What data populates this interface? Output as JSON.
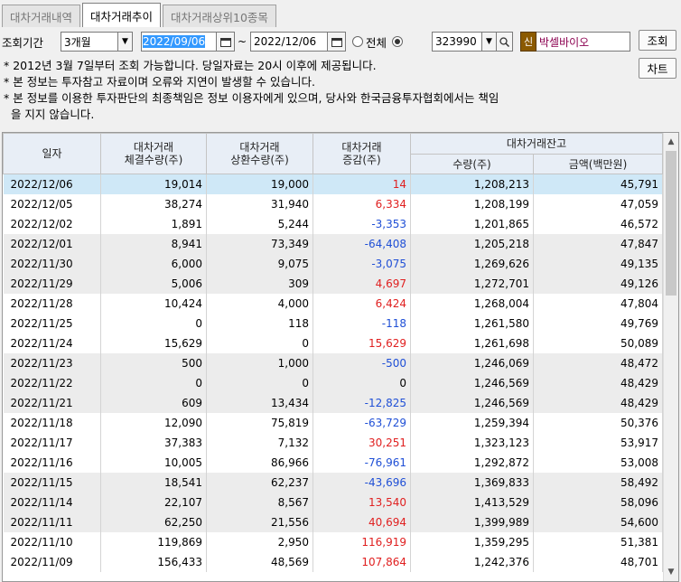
{
  "tabs": [
    "대차거래내역",
    "대차거래추이",
    "대차거래상위10종목"
  ],
  "filter": {
    "period_label": "조회기간",
    "period_value": "3개월",
    "date_from": "2022/09/06",
    "date_sep": "~",
    "date_to": "2022/12/06",
    "radio_all": "전체",
    "stock_code": "323990",
    "shin_badge": "신",
    "stock_name": "박셀바이오",
    "query_button": "조회",
    "chart_button": "차트"
  },
  "notes": [
    "* 2012년 3월 7일부터 조회 가능합니다. 당일자료는 20시 이후에 제공됩니다.",
    "* 본 정보는 투자참고 자료이며 오류와 지연이 발생할 수 있습니다.",
    "* 본 정보를 이용한 투자판단의 최종책임은 정보 이용자에게 있으며, 당사와 한국금융투자협회에서는 책임",
    "  을 지지 않습니다."
  ],
  "table": {
    "headers": {
      "date": "일자",
      "contract_1": "대차거래",
      "contract_2": "체결수량(주)",
      "repay_1": "대차거래",
      "repay_2": "상환수량(주)",
      "change_1": "대차거래",
      "change_2": "증감(주)",
      "balance": "대차거래잔고",
      "qty": "수량(주)",
      "amount": "금액(백만원)"
    },
    "rows": [
      [
        "2022/12/06",
        "19,014",
        "19,000",
        "14",
        "1,208,213",
        "45,791"
      ],
      [
        "2022/12/05",
        "38,274",
        "31,940",
        "6,334",
        "1,208,199",
        "47,059"
      ],
      [
        "2022/12/02",
        "1,891",
        "5,244",
        "-3,353",
        "1,201,865",
        "46,572"
      ],
      [
        "2022/12/01",
        "8,941",
        "73,349",
        "-64,408",
        "1,205,218",
        "47,847"
      ],
      [
        "2022/11/30",
        "6,000",
        "9,075",
        "-3,075",
        "1,269,626",
        "49,135"
      ],
      [
        "2022/11/29",
        "5,006",
        "309",
        "4,697",
        "1,272,701",
        "49,126"
      ],
      [
        "2022/11/28",
        "10,424",
        "4,000",
        "6,424",
        "1,268,004",
        "47,804"
      ],
      [
        "2022/11/25",
        "0",
        "118",
        "-118",
        "1,261,580",
        "49,769"
      ],
      [
        "2022/11/24",
        "15,629",
        "0",
        "15,629",
        "1,261,698",
        "50,089"
      ],
      [
        "2022/11/23",
        "500",
        "1,000",
        "-500",
        "1,246,069",
        "48,472"
      ],
      [
        "2022/11/22",
        "0",
        "0",
        "0",
        "1,246,569",
        "48,429"
      ],
      [
        "2022/11/21",
        "609",
        "13,434",
        "-12,825",
        "1,246,569",
        "48,429"
      ],
      [
        "2022/11/18",
        "12,090",
        "75,819",
        "-63,729",
        "1,259,394",
        "50,376"
      ],
      [
        "2022/11/17",
        "37,383",
        "7,132",
        "30,251",
        "1,323,123",
        "53,917"
      ],
      [
        "2022/11/16",
        "10,005",
        "86,966",
        "-76,961",
        "1,292,872",
        "53,008"
      ],
      [
        "2022/11/15",
        "18,541",
        "62,237",
        "-43,696",
        "1,369,833",
        "58,492"
      ],
      [
        "2022/11/14",
        "22,107",
        "8,567",
        "13,540",
        "1,413,529",
        "58,096"
      ],
      [
        "2022/11/11",
        "62,250",
        "21,556",
        "40,694",
        "1,399,989",
        "54,600"
      ],
      [
        "2022/11/10",
        "119,869",
        "2,950",
        "116,919",
        "1,359,295",
        "51,381"
      ],
      [
        "2022/11/09",
        "156,433",
        "48,569",
        "107,864",
        "1,242,376",
        "48,701"
      ]
    ]
  },
  "colors": {
    "positive": "#e02020",
    "negative": "#1f4fd6",
    "selected_row": "#cfe8f7",
    "header_bg": "#e8eef6",
    "badge_bg": "#8b5a00"
  }
}
